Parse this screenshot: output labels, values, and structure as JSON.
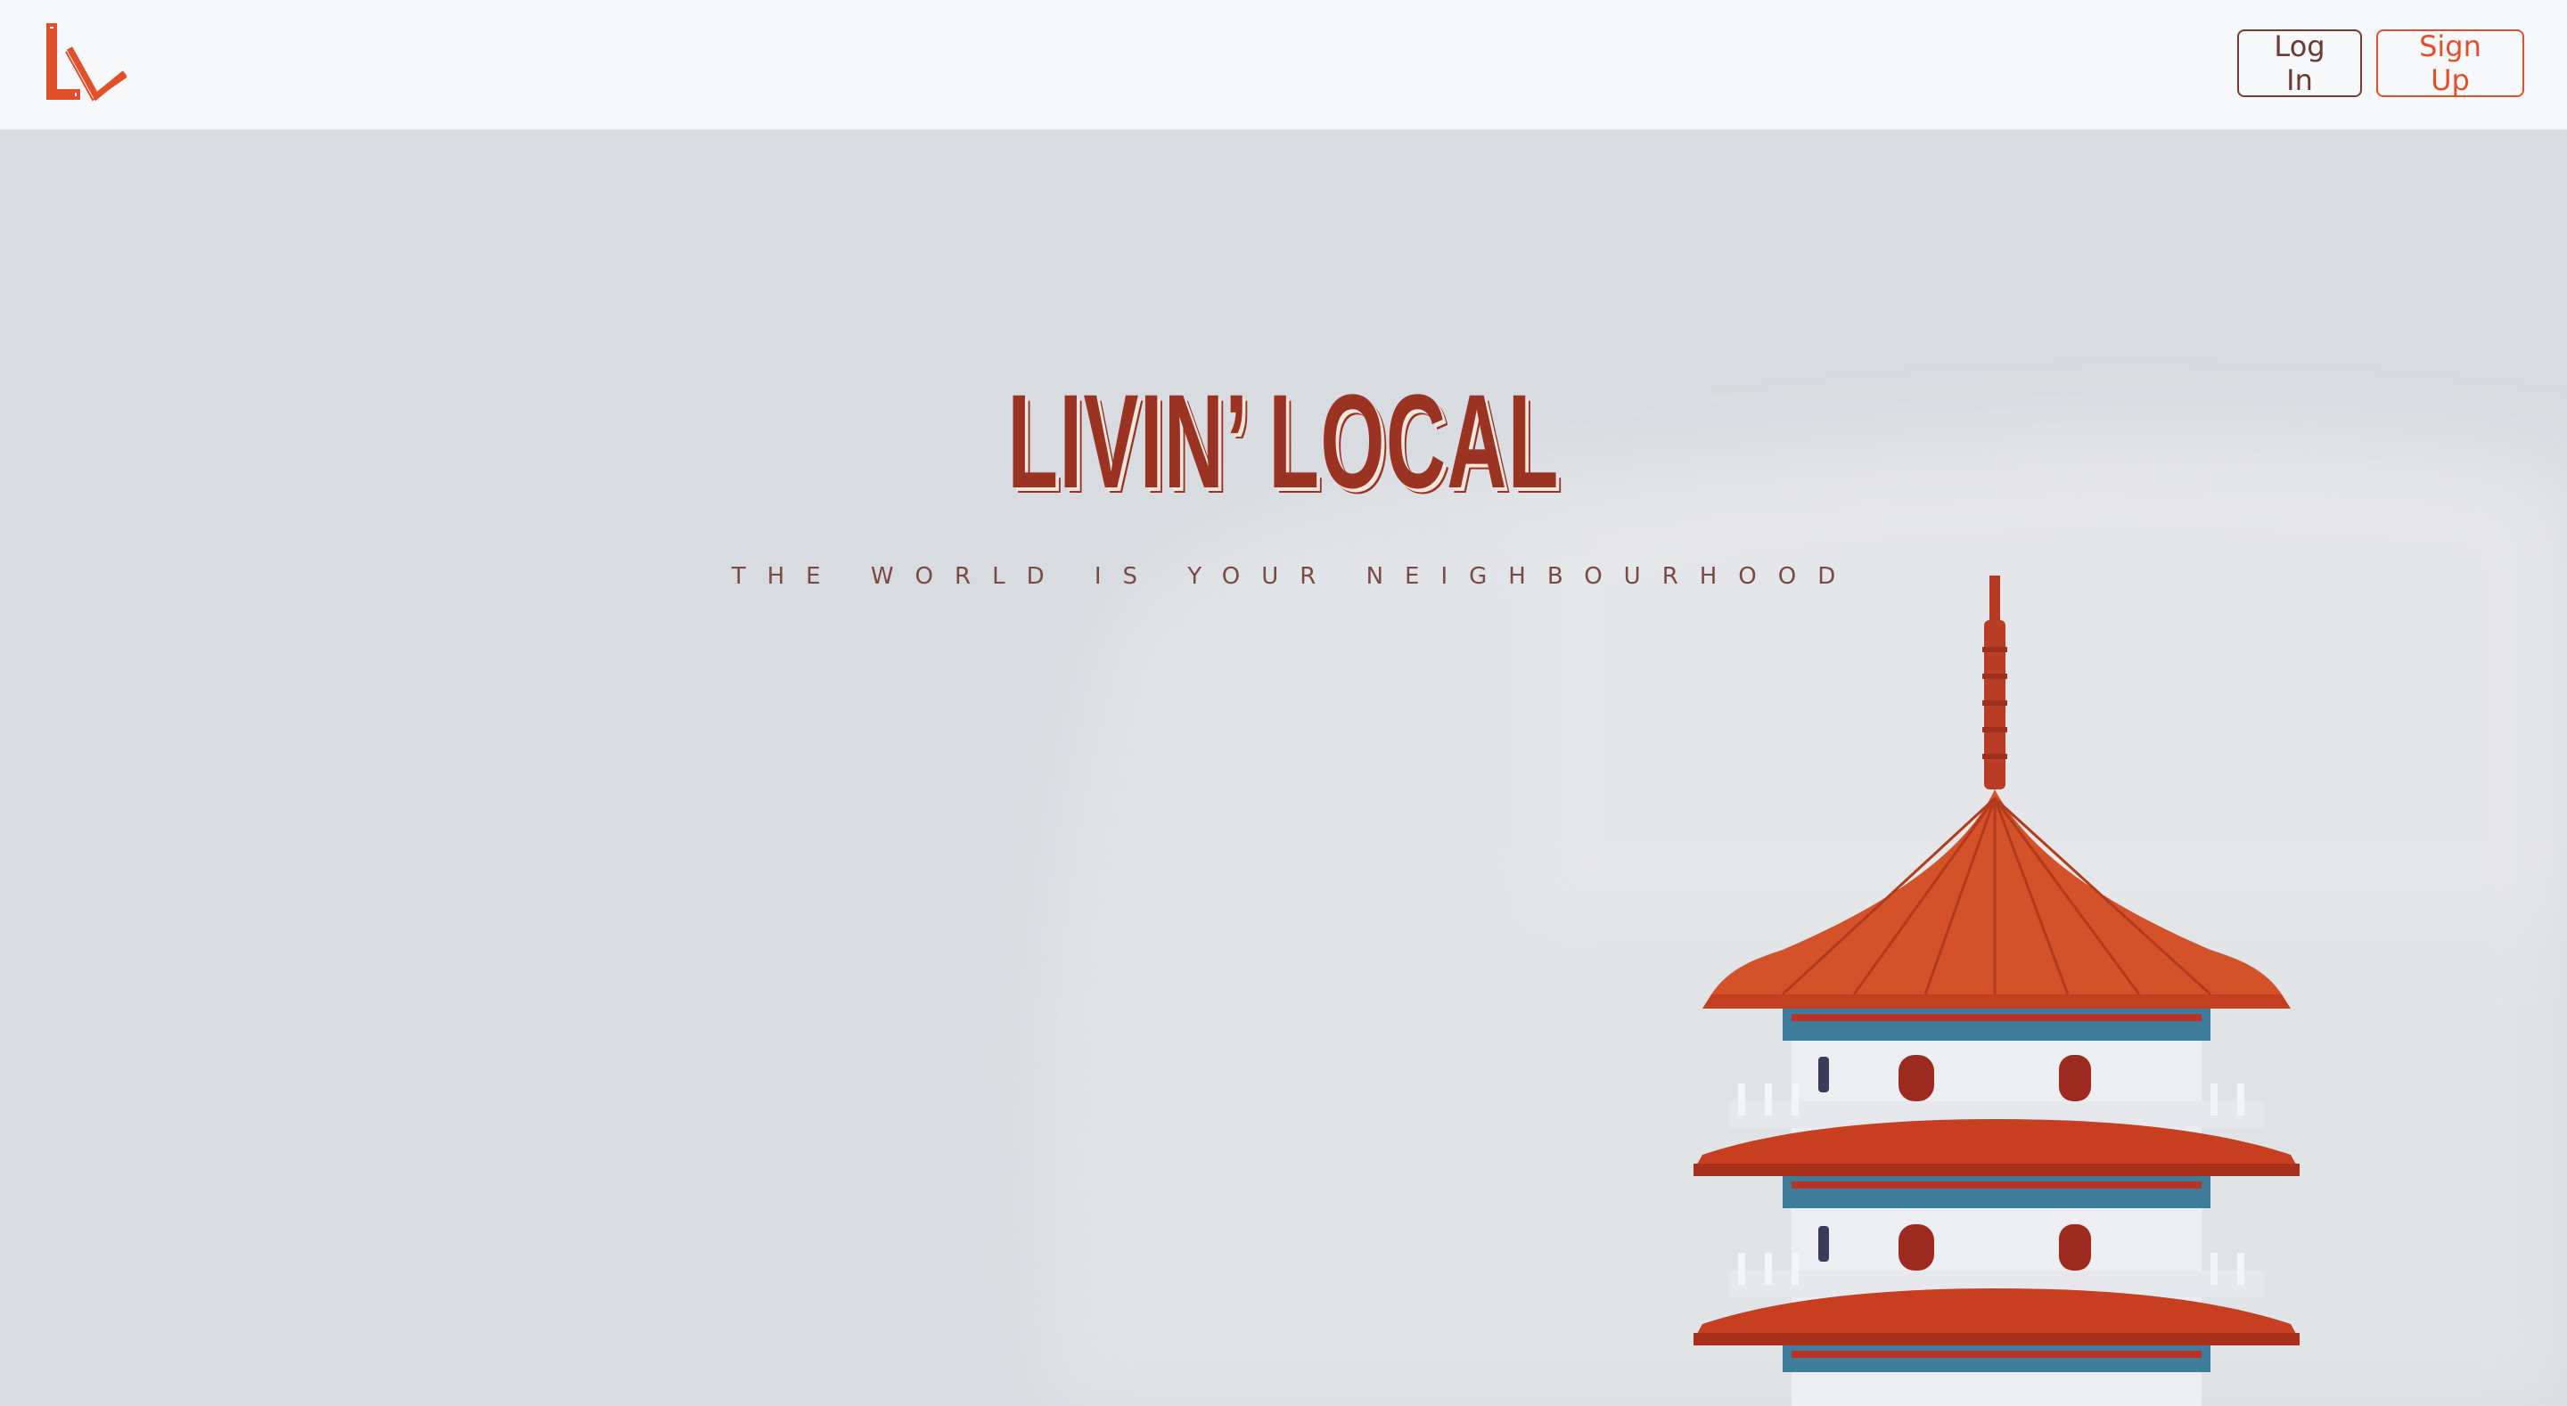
{
  "brand": {
    "logo_icon": "livin-local-logo-icon",
    "accent_color": "#e2502b",
    "dark_color": "#9a3322"
  },
  "nav": {
    "login_label": "Log In",
    "signup_label": "Sign Up"
  },
  "hero": {
    "title": "LIVIN’ LOCAL",
    "subtitle": "THE WORLD IS YOUR NEIGHBOURHOOD",
    "image_icon": "pagoda-illustration"
  }
}
